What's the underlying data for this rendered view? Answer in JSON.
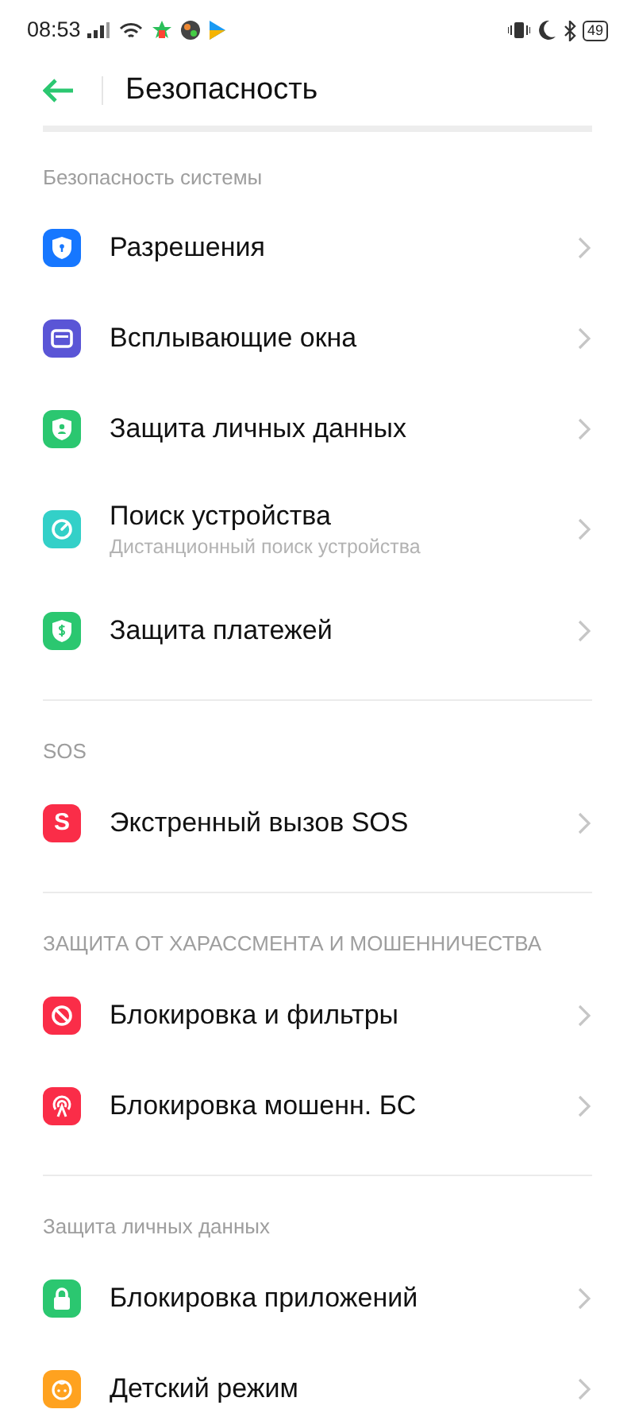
{
  "status_bar": {
    "time": "08:53",
    "battery": "49"
  },
  "header": {
    "title": "Безопасность"
  },
  "sections": [
    {
      "title": "Безопасность системы",
      "items": [
        {
          "label": "Разрешения",
          "kind": "shield-lock",
          "color": "#1677ff"
        },
        {
          "label": "Всплывающие окна",
          "kind": "window",
          "color": "#5a55d6"
        },
        {
          "label": "Защита личных данных",
          "kind": "shield-person",
          "color": "#2bc770"
        },
        {
          "label": "Поиск устройства",
          "subtitle": "Дистанционный поиск устройства",
          "kind": "locate",
          "color": "#33d0c8"
        },
        {
          "label": "Защита платежей",
          "kind": "shield-dollar",
          "color": "#2bc770"
        }
      ]
    },
    {
      "title": "SOS",
      "items": [
        {
          "label": "Экстренный вызов SOS",
          "kind": "letter",
          "glyph": "S",
          "color": "#fa2d48"
        }
      ]
    },
    {
      "title": "ЗАЩИТА ОТ ХАРАССМЕНТА И МОШЕННИЧЕСТВА",
      "items": [
        {
          "label": "Блокировка и фильтры",
          "kind": "block",
          "color": "#fa2d48"
        },
        {
          "label": "Блокировка мошенн. БС",
          "kind": "antenna",
          "color": "#fa2d48"
        }
      ]
    },
    {
      "title": "Защита личных данных",
      "items": [
        {
          "label": "Блокировка приложений",
          "kind": "lock",
          "color": "#2bc770"
        },
        {
          "label": "Детский режим",
          "kind": "child",
          "color": "#ffa21f"
        }
      ]
    }
  ]
}
